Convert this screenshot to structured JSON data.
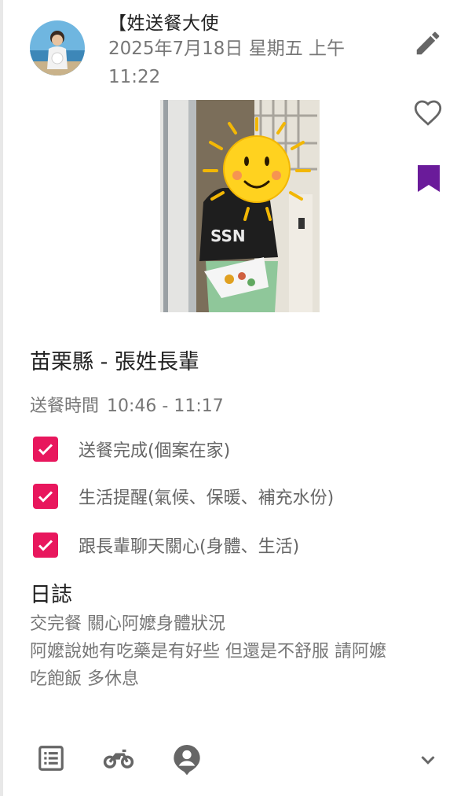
{
  "post": {
    "author": "【姓送餐大使",
    "date": "2025年7月18日 星期五 上午 11:22"
  },
  "header_icons": [
    "edit-icon",
    "heart-icon",
    "bookmark-icon"
  ],
  "title": "苗栗縣 - 張姓長輩",
  "delivery": {
    "label": "送餐時間",
    "time": "10:46 - 11:17"
  },
  "checklist": [
    {
      "label": "送餐完成(個案在家)",
      "checked": true
    },
    {
      "label": "生活提醒(氣候、保暖、補充水份)",
      "checked": true
    },
    {
      "label": "跟長輩聊天關心(身體、生活)",
      "checked": true
    }
  ],
  "log": {
    "title": "日誌",
    "lines": [
      "交完餐 關心阿嬤身體狀況",
      "阿嬤說她有吃藥是有好些 但還是不舒服 請阿嬤",
      "吃飽飯 多休息"
    ]
  },
  "footer_icons": [
    "list-icon",
    "motorcycle-icon",
    "person-pin-icon",
    "chevron-down-icon"
  ],
  "colors": {
    "check": "#e8175d",
    "bookmark": "#6a1b9a",
    "icon": "#666666",
    "muted_text": "#777777"
  }
}
